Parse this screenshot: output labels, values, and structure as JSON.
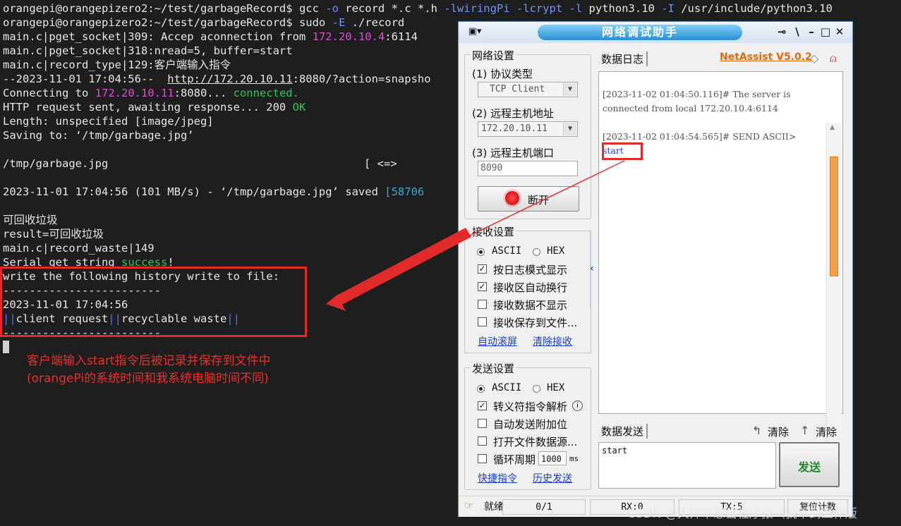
{
  "terminal": {
    "l1_prompt": "orangepi@orangepizero2:~/test/garbageRecord$ ",
    "l1_cmd": "gcc ",
    "l1_f1": "-o",
    "l1_mid": " record *.c *.h ",
    "l1_f2": "-lwiringPi -lcrypt -l",
    "l1_mid2": " python3.10 ",
    "l1_f3": "-I",
    "l1_end": " /usr/include/python3.10",
    "l2_prompt": "orangepi@orangepizero2:~/test/garbageRecord$ ",
    "l2_cmd": "sudo ",
    "l2_flag": "-E",
    "l2_end": " ./record",
    "l3_a": "main.c|pget_socket|309: Accep aconnection from ",
    "l3_ip": "172.20.10.4",
    "l3_b": ":6114",
    "l4": "main.c|pget_socket|318:nread=5, buffer=start",
    "l5": "main.c|record_type|129:客户端输入指令",
    "l6_a": "--2023-11-01 17:04:56--  ",
    "l6_link": "http://172.20.10.11",
    "l6_b": ":8080/?action=snapsho",
    "l7_a": "Connecting to ",
    "l7_ip": "172.20.10.11",
    "l7_b": ":8080... ",
    "l7_c": "connected.",
    "l8_a": "HTTP request sent, awaiting response... 200 ",
    "l8_ok": "OK",
    "l9": "Length: unspecified [image/jpeg]",
    "l10": "Saving to: ‘/tmp/garbage.jpg’",
    "l12_a": "/tmp/garbage.jpg",
    "l12_b": "[ <=>",
    "l14_a": "2023-11-01 17:04:56 (101 MB/s) - ‘/tmp/garbage.jpg’ saved ",
    "l14_b": "[58706",
    "l16": "可回收垃圾",
    "l17": "result=可回收垃圾",
    "l18": "main.c|record_waste|149",
    "l19_a": "Serial get string ",
    "l19_b": "success",
    "l19_c": "!",
    "l20": "write the following history write to file:",
    "l21": "------------------------",
    "l22": "2023-11-01 17:04:56",
    "l23_bar1": "||",
    "l23_a": "client request",
    "l23_bar2": "||",
    "l23_b": "recyclable waste",
    "l23_bar3": "||",
    "l24": "------------------------"
  },
  "annotation": {
    "line1": "客户端输入start指令后被记录并保存到文件中",
    "line2": "(orangePi的系统时间和我系统电脑时间不同)",
    "color": "#e8302c"
  },
  "app": {
    "title": "网络调试助手",
    "title_icons": [
      "app-menu-icon",
      "pin-icon",
      "help-icon",
      "minimize-icon",
      "maximize-icon",
      "close-icon"
    ],
    "version_link": "NetAssist V5.0.2",
    "net": {
      "group_title": "网络设置",
      "protocol_label": "(1) 协议类型",
      "protocol_value": "TCP Client",
      "host_label": "(2) 远程主机地址",
      "host_value": "172.20.10.11",
      "port_label": "(3) 远程主机端口",
      "port_value": "8090",
      "disconnect_label": "断开"
    },
    "recv": {
      "group_title": "接收设置",
      "ascii": "ASCII",
      "hex": "HEX",
      "mode": "ASCII",
      "opt1": "按日志模式显示",
      "opt1_checked": true,
      "opt2": "接收区自动换行",
      "opt2_checked": true,
      "opt3": "接收数据不显示",
      "opt3_checked": false,
      "opt4": "接收保存到文件...",
      "opt4_checked": false,
      "link1": "自动滚屏",
      "link2": "清除接收"
    },
    "send": {
      "group_title": "发送设置",
      "ascii": "ASCII",
      "hex": "HEX",
      "mode": "ASCII",
      "opt1": "转义符指令解析",
      "opt1_checked": true,
      "opt2": "自动发送附加位",
      "opt2_checked": false,
      "opt3": "打开文件数据源...",
      "opt3_checked": false,
      "opt4": "循环周期",
      "opt4_checked": false,
      "period_value": "1000",
      "period_unit": "ms",
      "link1": "快捷指令",
      "link2": "历史发送"
    },
    "log": {
      "tab_label": "数据日志",
      "entry1_l1": "[2023-11-02 01:04:50.116]# The server is",
      "entry1_l2": "connected from local 172.20.10.4:6114",
      "entry2_l1": "[2023-11-02 01:04:54.565]# SEND ASCII>",
      "entry2_l2": "start",
      "entry2_color": "#1f3fd6"
    },
    "sendarea": {
      "tab_label": "数据发送",
      "clear1": "清除",
      "clear2": "清除",
      "text": "start",
      "send_button": "发送",
      "send_color": "#1c8a2c"
    },
    "status": {
      "ready": "就绪",
      "count": "0/1",
      "rx": "RX:0",
      "tx": "TX:5",
      "reset": "复位计数"
    }
  },
  "watermark": "CSDN @大帅不想当程序猿（我不到工作版"
}
